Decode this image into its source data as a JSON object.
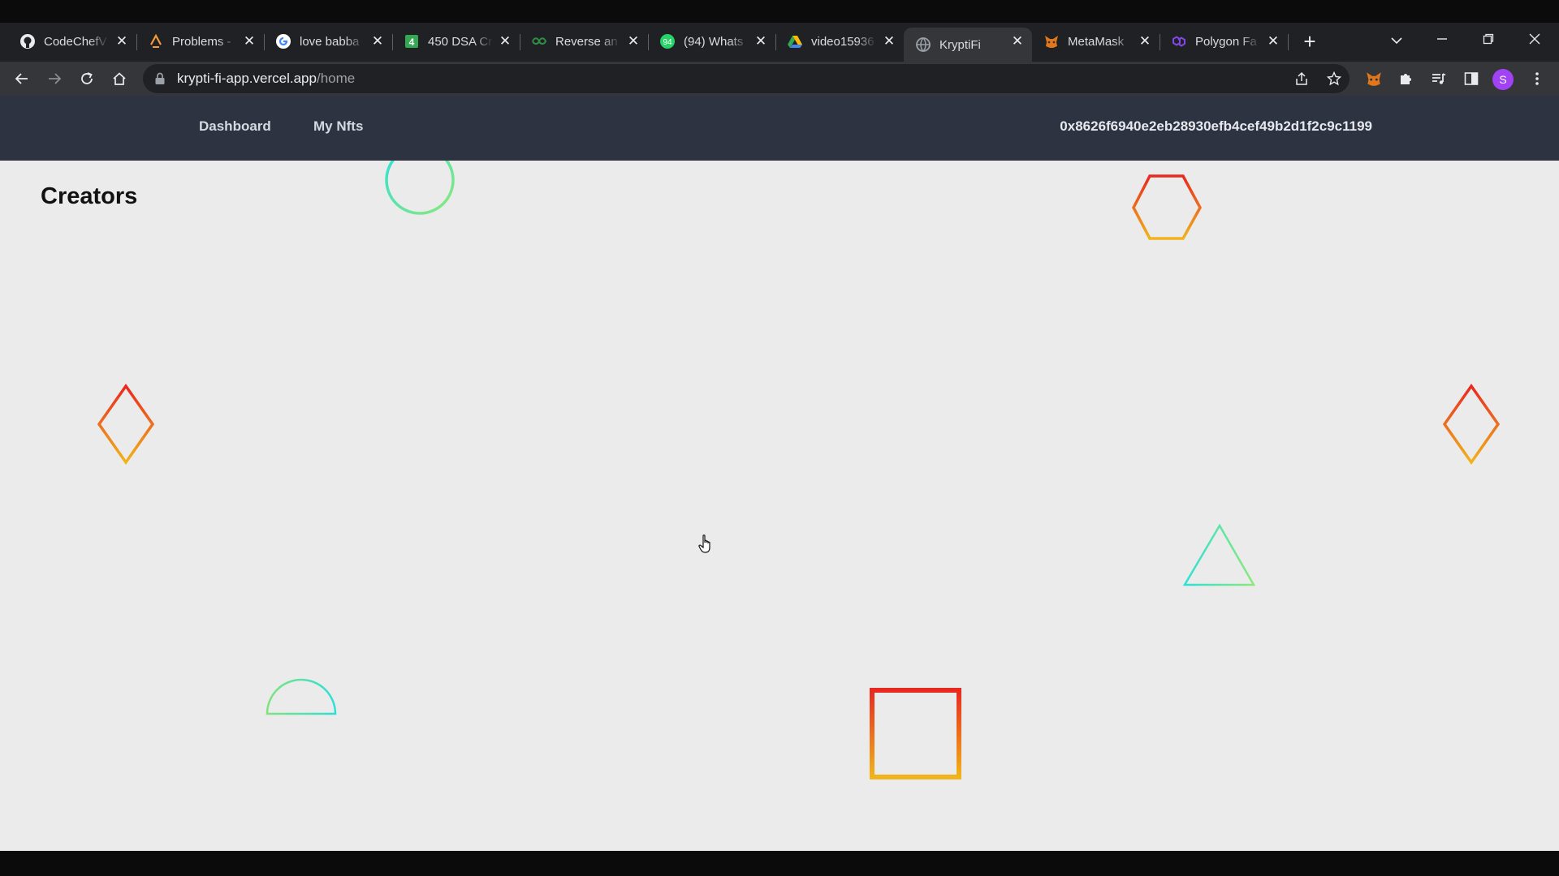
{
  "browser": {
    "tabs": [
      {
        "label": "CodeChefV",
        "icon": "github-icon"
      },
      {
        "label": "Problems -",
        "icon": "codingninjas-icon"
      },
      {
        "label": "love babba",
        "icon": "google-icon"
      },
      {
        "label": "450 DSA Cr",
        "icon": "sheets-icon"
      },
      {
        "label": "Reverse an",
        "icon": "gfg-icon"
      },
      {
        "label": "(94) Whats",
        "icon": "whatsapp-icon"
      },
      {
        "label": "video15936",
        "icon": "drive-icon"
      },
      {
        "label": "KryptiFi",
        "icon": "globe-icon",
        "active": true
      },
      {
        "label": "MetaMask",
        "icon": "metamask-icon"
      },
      {
        "label": "Polygon Fa",
        "icon": "polygon-icon"
      }
    ],
    "url_host": "krypti-fi-app.vercel.app",
    "url_path": "/home",
    "profile_initial": "S"
  },
  "app": {
    "nav": {
      "dashboard": "Dashboard",
      "my_nfts": "My Nfts",
      "wallet_address": "0x8626f6940e2eb28930efb4cef49b2d1f2c9c1199"
    },
    "heading": "Creators"
  },
  "colors": {
    "nav_bg": "#2d3340",
    "content_bg": "#ebebeb",
    "shape_warm_top": "#e8291f",
    "shape_warm_bottom": "#f0b41c",
    "shape_cool_a": "#2de0d6",
    "shape_cool_b": "#8de87a"
  }
}
